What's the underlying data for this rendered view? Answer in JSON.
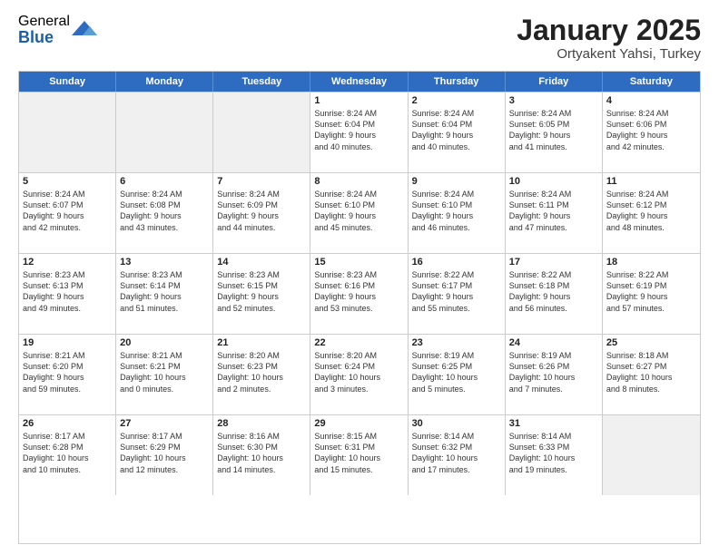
{
  "logo": {
    "general": "General",
    "blue": "Blue"
  },
  "title": {
    "month": "January 2025",
    "location": "Ortyakent Yahsi, Turkey"
  },
  "header_days": [
    "Sunday",
    "Monday",
    "Tuesday",
    "Wednesday",
    "Thursday",
    "Friday",
    "Saturday"
  ],
  "weeks": [
    [
      {
        "day": "",
        "lines": [],
        "shaded": true
      },
      {
        "day": "",
        "lines": [],
        "shaded": true
      },
      {
        "day": "",
        "lines": [],
        "shaded": true
      },
      {
        "day": "1",
        "lines": [
          "Sunrise: 8:24 AM",
          "Sunset: 6:04 PM",
          "Daylight: 9 hours",
          "and 40 minutes."
        ]
      },
      {
        "day": "2",
        "lines": [
          "Sunrise: 8:24 AM",
          "Sunset: 6:04 PM",
          "Daylight: 9 hours",
          "and 40 minutes."
        ]
      },
      {
        "day": "3",
        "lines": [
          "Sunrise: 8:24 AM",
          "Sunset: 6:05 PM",
          "Daylight: 9 hours",
          "and 41 minutes."
        ]
      },
      {
        "day": "4",
        "lines": [
          "Sunrise: 8:24 AM",
          "Sunset: 6:06 PM",
          "Daylight: 9 hours",
          "and 42 minutes."
        ]
      }
    ],
    [
      {
        "day": "5",
        "lines": [
          "Sunrise: 8:24 AM",
          "Sunset: 6:07 PM",
          "Daylight: 9 hours",
          "and 42 minutes."
        ]
      },
      {
        "day": "6",
        "lines": [
          "Sunrise: 8:24 AM",
          "Sunset: 6:08 PM",
          "Daylight: 9 hours",
          "and 43 minutes."
        ]
      },
      {
        "day": "7",
        "lines": [
          "Sunrise: 8:24 AM",
          "Sunset: 6:09 PM",
          "Daylight: 9 hours",
          "and 44 minutes."
        ]
      },
      {
        "day": "8",
        "lines": [
          "Sunrise: 8:24 AM",
          "Sunset: 6:10 PM",
          "Daylight: 9 hours",
          "and 45 minutes."
        ]
      },
      {
        "day": "9",
        "lines": [
          "Sunrise: 8:24 AM",
          "Sunset: 6:10 PM",
          "Daylight: 9 hours",
          "and 46 minutes."
        ]
      },
      {
        "day": "10",
        "lines": [
          "Sunrise: 8:24 AM",
          "Sunset: 6:11 PM",
          "Daylight: 9 hours",
          "and 47 minutes."
        ]
      },
      {
        "day": "11",
        "lines": [
          "Sunrise: 8:24 AM",
          "Sunset: 6:12 PM",
          "Daylight: 9 hours",
          "and 48 minutes."
        ]
      }
    ],
    [
      {
        "day": "12",
        "lines": [
          "Sunrise: 8:23 AM",
          "Sunset: 6:13 PM",
          "Daylight: 9 hours",
          "and 49 minutes."
        ]
      },
      {
        "day": "13",
        "lines": [
          "Sunrise: 8:23 AM",
          "Sunset: 6:14 PM",
          "Daylight: 9 hours",
          "and 51 minutes."
        ]
      },
      {
        "day": "14",
        "lines": [
          "Sunrise: 8:23 AM",
          "Sunset: 6:15 PM",
          "Daylight: 9 hours",
          "and 52 minutes."
        ]
      },
      {
        "day": "15",
        "lines": [
          "Sunrise: 8:23 AM",
          "Sunset: 6:16 PM",
          "Daylight: 9 hours",
          "and 53 minutes."
        ]
      },
      {
        "day": "16",
        "lines": [
          "Sunrise: 8:22 AM",
          "Sunset: 6:17 PM",
          "Daylight: 9 hours",
          "and 55 minutes."
        ]
      },
      {
        "day": "17",
        "lines": [
          "Sunrise: 8:22 AM",
          "Sunset: 6:18 PM",
          "Daylight: 9 hours",
          "and 56 minutes."
        ]
      },
      {
        "day": "18",
        "lines": [
          "Sunrise: 8:22 AM",
          "Sunset: 6:19 PM",
          "Daylight: 9 hours",
          "and 57 minutes."
        ]
      }
    ],
    [
      {
        "day": "19",
        "lines": [
          "Sunrise: 8:21 AM",
          "Sunset: 6:20 PM",
          "Daylight: 9 hours",
          "and 59 minutes."
        ]
      },
      {
        "day": "20",
        "lines": [
          "Sunrise: 8:21 AM",
          "Sunset: 6:21 PM",
          "Daylight: 10 hours",
          "and 0 minutes."
        ]
      },
      {
        "day": "21",
        "lines": [
          "Sunrise: 8:20 AM",
          "Sunset: 6:23 PM",
          "Daylight: 10 hours",
          "and 2 minutes."
        ]
      },
      {
        "day": "22",
        "lines": [
          "Sunrise: 8:20 AM",
          "Sunset: 6:24 PM",
          "Daylight: 10 hours",
          "and 3 minutes."
        ]
      },
      {
        "day": "23",
        "lines": [
          "Sunrise: 8:19 AM",
          "Sunset: 6:25 PM",
          "Daylight: 10 hours",
          "and 5 minutes."
        ]
      },
      {
        "day": "24",
        "lines": [
          "Sunrise: 8:19 AM",
          "Sunset: 6:26 PM",
          "Daylight: 10 hours",
          "and 7 minutes."
        ]
      },
      {
        "day": "25",
        "lines": [
          "Sunrise: 8:18 AM",
          "Sunset: 6:27 PM",
          "Daylight: 10 hours",
          "and 8 minutes."
        ]
      }
    ],
    [
      {
        "day": "26",
        "lines": [
          "Sunrise: 8:17 AM",
          "Sunset: 6:28 PM",
          "Daylight: 10 hours",
          "and 10 minutes."
        ]
      },
      {
        "day": "27",
        "lines": [
          "Sunrise: 8:17 AM",
          "Sunset: 6:29 PM",
          "Daylight: 10 hours",
          "and 12 minutes."
        ]
      },
      {
        "day": "28",
        "lines": [
          "Sunrise: 8:16 AM",
          "Sunset: 6:30 PM",
          "Daylight: 10 hours",
          "and 14 minutes."
        ]
      },
      {
        "day": "29",
        "lines": [
          "Sunrise: 8:15 AM",
          "Sunset: 6:31 PM",
          "Daylight: 10 hours",
          "and 15 minutes."
        ]
      },
      {
        "day": "30",
        "lines": [
          "Sunrise: 8:14 AM",
          "Sunset: 6:32 PM",
          "Daylight: 10 hours",
          "and 17 minutes."
        ]
      },
      {
        "day": "31",
        "lines": [
          "Sunrise: 8:14 AM",
          "Sunset: 6:33 PM",
          "Daylight: 10 hours",
          "and 19 minutes."
        ]
      },
      {
        "day": "",
        "lines": [],
        "shaded": true
      }
    ]
  ]
}
